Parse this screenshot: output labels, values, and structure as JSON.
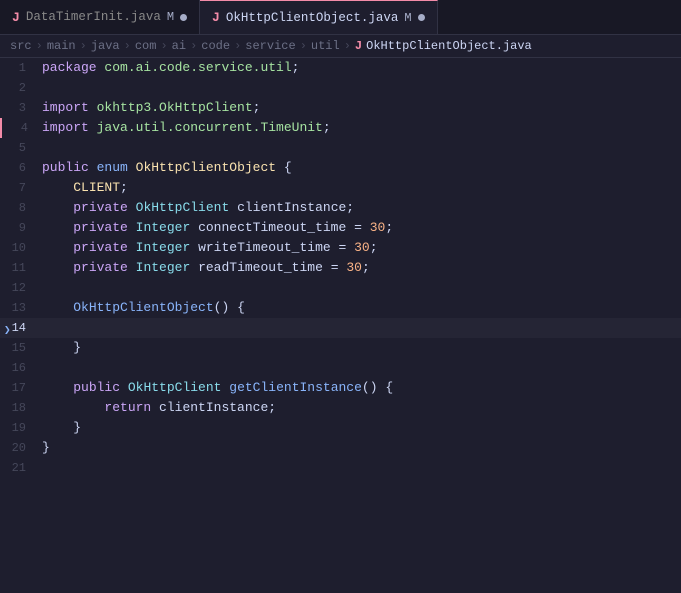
{
  "tabs": [
    {
      "id": "tab1",
      "icon": "J",
      "label": "DataTimerInit.java",
      "modified": true,
      "unsaved_dot": true,
      "active": false
    },
    {
      "id": "tab2",
      "icon": "J",
      "label": "OkHttpClientObject.java",
      "modified": true,
      "unsaved_dot": true,
      "active": true
    }
  ],
  "breadcrumb": {
    "parts": [
      "src",
      "main",
      "java",
      "com",
      "ai",
      "code",
      "service",
      "util"
    ],
    "file_icon": "J",
    "filename": "OkHttpClientObject.java"
  },
  "lines": [
    {
      "num": "1",
      "content": "package com.ai.code.service.util;"
    },
    {
      "num": "2",
      "content": ""
    },
    {
      "num": "3",
      "content": "import okhttp3.OkHttpClient;"
    },
    {
      "num": "4",
      "content": "import java.util.concurrent.TimeUnit;"
    },
    {
      "num": "5",
      "content": ""
    },
    {
      "num": "6",
      "content": "public enum OkHttpClientObject {"
    },
    {
      "num": "7",
      "content": "    CLIENT;"
    },
    {
      "num": "8",
      "content": "    private OkHttpClient clientInstance;"
    },
    {
      "num": "9",
      "content": "    private Integer connectTimeout_time = 30;"
    },
    {
      "num": "10",
      "content": "    private Integer writeTimeout_time = 30;"
    },
    {
      "num": "11",
      "content": "    private Integer readTimeout_time = 30;"
    },
    {
      "num": "12",
      "content": ""
    },
    {
      "num": "13",
      "content": "    OkHttpClientObject() {"
    },
    {
      "num": "14",
      "content": ""
    },
    {
      "num": "15",
      "content": "    }"
    },
    {
      "num": "16",
      "content": ""
    },
    {
      "num": "17",
      "content": "    public OkHttpClient getClientInstance() {"
    },
    {
      "num": "18",
      "content": "        return clientInstance;"
    },
    {
      "num": "19",
      "content": "    }"
    },
    {
      "num": "20",
      "content": "}"
    },
    {
      "num": "21",
      "content": ""
    }
  ],
  "colors": {
    "accent": "#f38ba8",
    "background": "#1e1e2e",
    "tab_bar_bg": "#181825"
  }
}
